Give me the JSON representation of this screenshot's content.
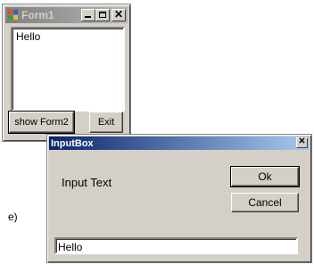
{
  "form1": {
    "title": "Form1",
    "list_items": [
      "Hello"
    ],
    "show_form2_label": "show Form2",
    "exit_label": "Exit",
    "close_glyph": "✕"
  },
  "inputbox": {
    "title": "InputBox",
    "prompt": "Input Text",
    "ok_label": "Ok",
    "cancel_label": "Cancel",
    "input_value": "Hello",
    "close_glyph": "✕"
  },
  "side_label": "e)",
  "colors": {
    "window_face": "#d4d0c8",
    "active_title_start": "#0a246a",
    "active_title_end": "#a6caf0",
    "inactive_title_start": "#808080",
    "inactive_title_end": "#b5b5b5"
  },
  "icons": {
    "form1_app_icon": "windows-app-icon",
    "form1_minimize": "minimize-icon",
    "form1_maximize": "maximize-icon",
    "form1_close": "close-icon",
    "inputbox_close": "close-icon"
  }
}
